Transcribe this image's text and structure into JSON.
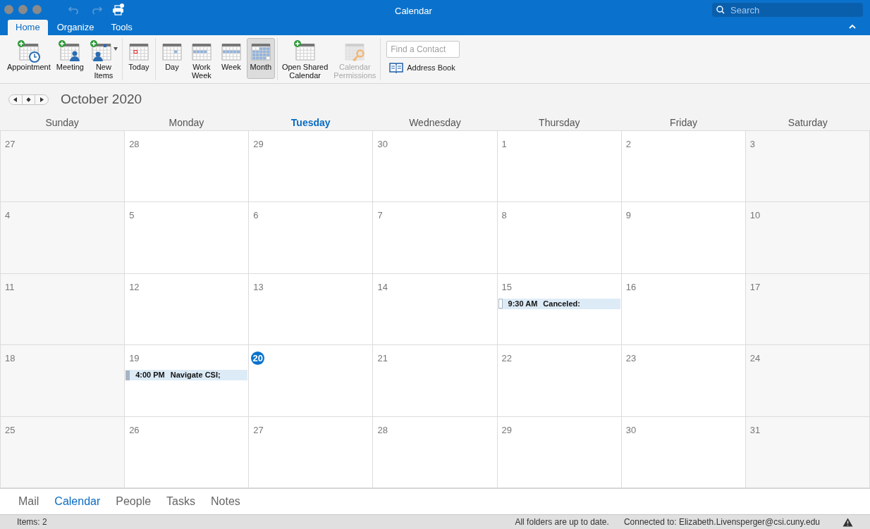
{
  "window": {
    "title": "Calendar",
    "search_placeholder": "Search"
  },
  "ribbon_tabs": [
    {
      "label": "Home",
      "selected": true
    },
    {
      "label": "Organize",
      "selected": false
    },
    {
      "label": "Tools",
      "selected": false
    }
  ],
  "ribbon_groups": [
    [
      {
        "label": "Appointment",
        "kind": "appointment",
        "selected": false,
        "disabled": false,
        "dropdown": false
      },
      {
        "label": "Meeting",
        "kind": "meeting",
        "selected": false,
        "disabled": false,
        "dropdown": false
      },
      {
        "label": "New\nItems",
        "kind": "new-items",
        "selected": false,
        "disabled": false,
        "dropdown": true
      }
    ],
    [
      {
        "label": "Today",
        "kind": "today",
        "selected": false,
        "disabled": false,
        "dropdown": false
      }
    ],
    [
      {
        "label": "Day",
        "kind": "day",
        "selected": false,
        "disabled": false,
        "dropdown": false
      },
      {
        "label": "Work\nWeek",
        "kind": "work-week",
        "selected": false,
        "disabled": false,
        "dropdown": false
      },
      {
        "label": "Week",
        "kind": "week",
        "selected": false,
        "disabled": false,
        "dropdown": false
      },
      {
        "label": "Month",
        "kind": "month",
        "selected": true,
        "disabled": false,
        "dropdown": false
      }
    ],
    [
      {
        "label": "Open Shared\nCalendar",
        "kind": "shared",
        "selected": false,
        "disabled": false,
        "dropdown": false
      },
      {
        "label": "Calendar\nPermissions",
        "kind": "permissions",
        "selected": false,
        "disabled": true,
        "dropdown": false
      }
    ]
  ],
  "find_contact": {
    "placeholder": "Find a Contact"
  },
  "address_book": "Address Book",
  "month_title": "October 2020",
  "weekdays": [
    {
      "label": "Sunday",
      "selected": false
    },
    {
      "label": "Monday",
      "selected": false
    },
    {
      "label": "Tuesday",
      "selected": true
    },
    {
      "label": "Wednesday",
      "selected": false
    },
    {
      "label": "Thursday",
      "selected": false
    },
    {
      "label": "Friday",
      "selected": false
    },
    {
      "label": "Saturday",
      "selected": false
    }
  ],
  "weeks": [
    [
      {
        "day": "27",
        "today": false
      },
      {
        "day": "28",
        "today": false
      },
      {
        "day": "29",
        "today": false
      },
      {
        "day": "30",
        "today": false
      },
      {
        "day": "1",
        "today": false
      },
      {
        "day": "2",
        "today": false
      },
      {
        "day": "3",
        "today": false
      }
    ],
    [
      {
        "day": "4",
        "today": false
      },
      {
        "day": "5",
        "today": false
      },
      {
        "day": "6",
        "today": false
      },
      {
        "day": "7",
        "today": false
      },
      {
        "day": "8",
        "today": false
      },
      {
        "day": "9",
        "today": false
      },
      {
        "day": "10",
        "today": false
      }
    ],
    [
      {
        "day": "11",
        "today": false
      },
      {
        "day": "12",
        "today": false
      },
      {
        "day": "13",
        "today": false
      },
      {
        "day": "14",
        "today": false
      },
      {
        "day": "15",
        "today": false,
        "events": [
          {
            "time": "9:30 AM",
            "title": "Canceled:",
            "kind": "free"
          }
        ]
      },
      {
        "day": "16",
        "today": false
      },
      {
        "day": "17",
        "today": false
      }
    ],
    [
      {
        "day": "18",
        "today": false
      },
      {
        "day": "19",
        "today": false,
        "events": [
          {
            "time": "4:00 PM",
            "title": "Navigate CSI;",
            "kind": "busy"
          }
        ]
      },
      {
        "day": "20",
        "today": true
      },
      {
        "day": "21",
        "today": false
      },
      {
        "day": "22",
        "today": false
      },
      {
        "day": "23",
        "today": false
      },
      {
        "day": "24",
        "today": false
      }
    ],
    [
      {
        "day": "25",
        "today": false
      },
      {
        "day": "26",
        "today": false
      },
      {
        "day": "27",
        "today": false
      },
      {
        "day": "28",
        "today": false
      },
      {
        "day": "29",
        "today": false
      },
      {
        "day": "30",
        "today": false
      },
      {
        "day": "31",
        "today": false
      }
    ]
  ],
  "nav": [
    {
      "label": "Mail",
      "selected": false
    },
    {
      "label": "Calendar",
      "selected": true
    },
    {
      "label": "People",
      "selected": false
    },
    {
      "label": "Tasks",
      "selected": false
    },
    {
      "label": "Notes",
      "selected": false
    }
  ],
  "status_bar": {
    "items": "Items: 2",
    "sync": "All folders are up to date.",
    "connection": "Connected to: Elizabeth.Livensperger@csi.cuny.edu"
  }
}
